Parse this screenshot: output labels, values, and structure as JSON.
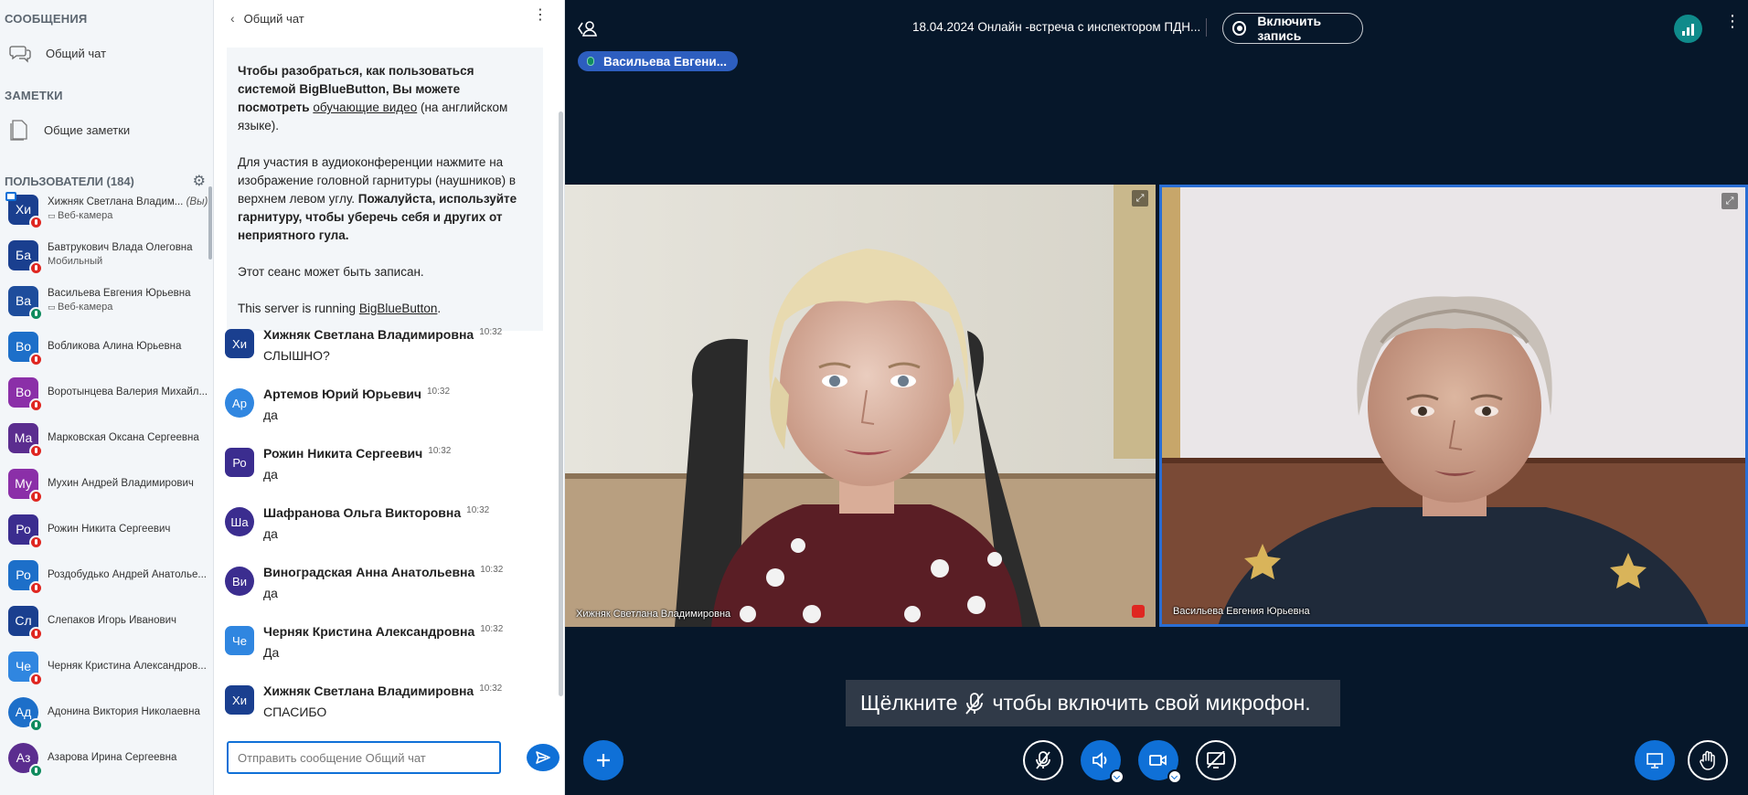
{
  "sidebar": {
    "messages_title": "СООБЩЕНИЯ",
    "public_chat": "Общий чат",
    "notes_title": "ЗАМЕТКИ",
    "shared_notes": "Общие заметки",
    "users_title": "ПОЛЬЗОВАТЕЛИ (184)",
    "users": [
      {
        "initials": "Хи",
        "name": "Хижняк Светлана Владим...",
        "you": "(Вы)",
        "sub": "Веб-камера",
        "color": "#1a3f8f",
        "status": "muted",
        "presenter": true
      },
      {
        "initials": "Ба",
        "name": "Бавтрукович Влада Олеговна",
        "sub": "Мобильный",
        "color": "#1a3f8f",
        "status": "muted"
      },
      {
        "initials": "Ва",
        "name": "Васильева Евгения Юрьевна",
        "sub": "Веб-камера",
        "color": "#1e4d9c",
        "status": "listen"
      },
      {
        "initials": "Во",
        "name": "Вобликова Алина Юрьевна",
        "sub": "",
        "color": "#1d6fc9",
        "status": "muted"
      },
      {
        "initials": "Во",
        "name": "Воротынцева Валерия Михайл...",
        "sub": "",
        "color": "#8b2fa8",
        "status": "muted"
      },
      {
        "initials": "Ма",
        "name": "Марковская Оксана Сергеевна",
        "sub": "",
        "color": "#5b2d8f",
        "status": "muted"
      },
      {
        "initials": "Му",
        "name": "Мухин Андрей Владимирович",
        "sub": "",
        "color": "#8b2fa8",
        "status": "muted"
      },
      {
        "initials": "Ро",
        "name": "Рожин Никита Сергеевич",
        "sub": "",
        "color": "#3b2d8f",
        "status": "muted"
      },
      {
        "initials": "Ро",
        "name": "Роздобудько Андрей Анатолье...",
        "sub": "",
        "color": "#1d6fc9",
        "status": "muted"
      },
      {
        "initials": "Сл",
        "name": "Слепаков Игорь Иванович",
        "sub": "",
        "color": "#1a3f8f",
        "status": "muted"
      },
      {
        "initials": "Че",
        "name": "Черняк Кристина Александров...",
        "sub": "",
        "color": "#3086e0",
        "status": "muted"
      },
      {
        "initials": "Ад",
        "name": "Адонина Виктория Николаевна",
        "sub": "",
        "color": "#1d6fc9",
        "status": "listen",
        "round": true
      },
      {
        "initials": "Аз",
        "name": "Азарова Ирина Сергеевна",
        "sub": "",
        "color": "#5b2d8f",
        "status": "listen",
        "round": true
      }
    ]
  },
  "chat": {
    "header": "Общий чат",
    "welcome_p1_a": "Чтобы разобраться, как пользоваться системой BigBlueButton, Вы можете посмотреть",
    "welcome_p1_link": "обучающие видео",
    "welcome_p1_b": "(на английском языке).",
    "welcome_p2_a": "Для участия в аудиоконференции нажмите на изображение головной гарнитуры (наушников) в верхнем левом углу.",
    "welcome_p2_b": "Пожалуйста, используйте гарнитуру, чтобы уберечь себя и других от неприятного гула.",
    "welcome_p3": "Этот сеанс может быть записан.",
    "welcome_p4_a": "This server is running",
    "welcome_p4_link": "BigBlueButton",
    "messages": [
      {
        "initials": "Хи",
        "name": "Хижняк Светлана Владимировна",
        "time": "10:32",
        "text": "СЛЫШНО?",
        "color": "#1a3f8f",
        "round": false
      },
      {
        "initials": "Ар",
        "name": "Артемов Юрий Юрьевич",
        "time": "10:32",
        "text": "да",
        "color": "#3086e0",
        "round": true
      },
      {
        "initials": "Ро",
        "name": "Рожин Никита Сергеевич",
        "time": "10:32",
        "text": "да",
        "color": "#3b2d8f",
        "round": false
      },
      {
        "initials": "Ша",
        "name": "Шафранова Ольга Викторовна",
        "time": "10:32",
        "text": "да",
        "color": "#3b2d8f",
        "round": true
      },
      {
        "initials": "Ви",
        "name": "Виноградская Анна Анатольевна",
        "time": "10:32",
        "text": "да",
        "color": "#3b2d8f",
        "round": true
      },
      {
        "initials": "Че",
        "name": "Черняк Кристина Александровна",
        "time": "10:32",
        "text": "Да",
        "color": "#3086e0",
        "round": false
      },
      {
        "initials": "Хи",
        "name": "Хижняк Светлана Владимировна",
        "time": "10:32",
        "text": "СПАСИБО",
        "color": "#1a3f8f",
        "round": false
      }
    ],
    "input_placeholder": "Отправить сообщение Общий чат"
  },
  "main": {
    "meeting_title": "18.04.2024 Онлайн -встреча с инспектором ПДН...",
    "record_label": "Включить запись",
    "talker": "Васильева Евгени...",
    "video1_name": "Хижняк Светлана Владимировна",
    "video2_name": "Васильева Евгения Юрьевна",
    "mic_notice_a": "Щёлкните",
    "mic_notice_b": "чтобы включить свой микрофон."
  },
  "colors": {
    "accent": "#0f70d7",
    "main_bg": "#06172a",
    "muted": "#df2721",
    "listen": "#0f8b5e"
  }
}
